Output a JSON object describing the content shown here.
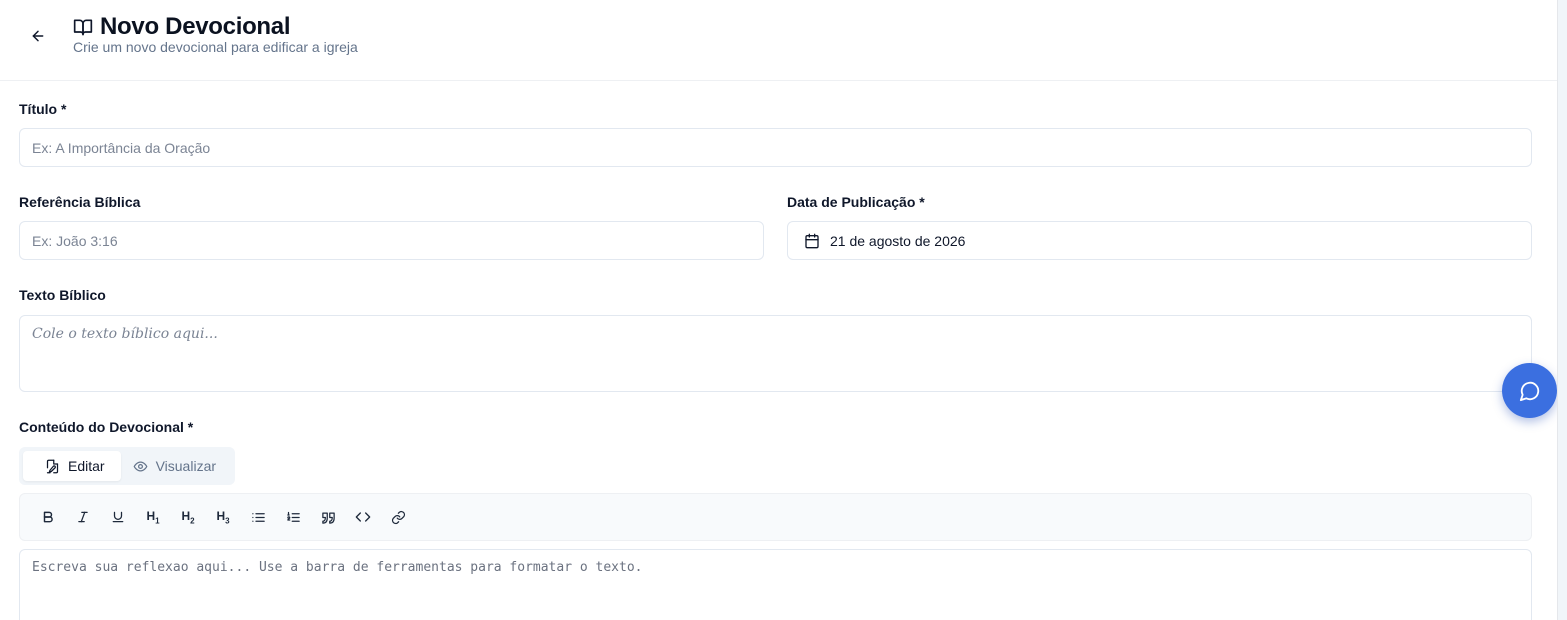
{
  "header": {
    "title": "Novo Devocional",
    "subtitle": "Crie um novo devocional para edificar a igreja",
    "back_icon": "arrow-left-icon",
    "title_icon": "open-book-icon"
  },
  "form": {
    "titulo": {
      "label": "Título *",
      "placeholder": "Ex: A Importância da Oração",
      "value": ""
    },
    "referencia": {
      "label": "Referência Bíblica",
      "placeholder": "Ex: João 3:16",
      "value": ""
    },
    "data_publicacao": {
      "label": "Data de Publicação *",
      "value": "21 de agosto de 2026",
      "icon": "calendar-icon"
    },
    "texto_biblico": {
      "label": "Texto Bíblico",
      "placeholder": "Cole o texto bíblico aqui...",
      "value": ""
    },
    "conteudo": {
      "label": "Conteúdo do Devocional *",
      "tabs": [
        {
          "label": "Editar",
          "icon": "edit-file-icon",
          "active": true
        },
        {
          "label": "Visualizar",
          "icon": "eye-icon",
          "active": false
        }
      ],
      "toolbar": [
        {
          "name": "bold",
          "icon": "bold-icon"
        },
        {
          "name": "italic",
          "icon": "italic-icon"
        },
        {
          "name": "underline",
          "icon": "underline-icon"
        },
        {
          "name": "heading1",
          "text": "H",
          "sub": "1"
        },
        {
          "name": "heading2",
          "text": "H",
          "sub": "2"
        },
        {
          "name": "heading3",
          "text": "H",
          "sub": "3"
        },
        {
          "name": "bullet-list",
          "icon": "list-icon"
        },
        {
          "name": "ordered-list",
          "icon": "ordered-list-icon"
        },
        {
          "name": "quote",
          "icon": "quote-icon"
        },
        {
          "name": "code",
          "icon": "code-icon"
        },
        {
          "name": "link",
          "icon": "link-icon"
        }
      ],
      "placeholder": "Escreva sua reflexao aqui... Use a barra de ferramentas para formatar o texto.",
      "value": ""
    }
  },
  "chat": {
    "icon": "chat-bubble-icon"
  },
  "colors": {
    "accent": "#3b6fe0",
    "border": "#e2e8f0",
    "muted_text": "#64748b",
    "text": "#0f172a"
  }
}
